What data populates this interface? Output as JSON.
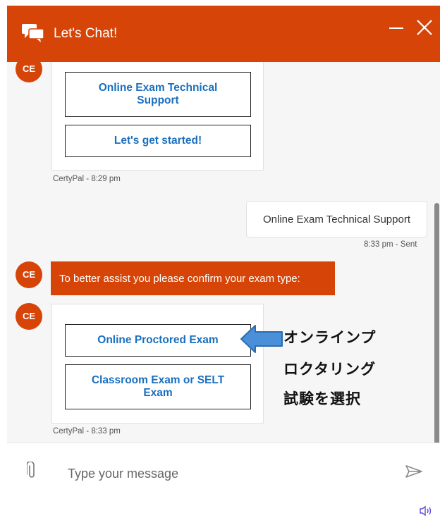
{
  "header": {
    "title": "Let's Chat!",
    "minimize_label": "—",
    "close_label": "✕"
  },
  "colors": {
    "brand": "#d64507",
    "link": "#1a6fbf",
    "background": "#f6f6f6"
  },
  "messages": {
    "avatar_initials": "CE",
    "card1": {
      "buttons": [
        "Online Exam Technical Support",
        "Let's get started!"
      ],
      "meta": "CertyPal - 8:29 pm"
    },
    "user_reply": {
      "text": "Online Exam Technical Support",
      "meta": "8:33 pm - Sent"
    },
    "bot_prompt": "To better assist you please confirm your exam type:",
    "card2": {
      "buttons": [
        "Online Proctored Exam",
        "Classroom Exam or SELT Exam"
      ],
      "meta": "CertyPal - 8:33 pm"
    }
  },
  "annotation": {
    "lines": [
      "オンラインプ",
      "ロクタリング",
      "試験を選択"
    ]
  },
  "composer": {
    "placeholder": "Type your message",
    "icons": [
      "paperclip-icon",
      "send-icon",
      "sound-icon"
    ]
  }
}
